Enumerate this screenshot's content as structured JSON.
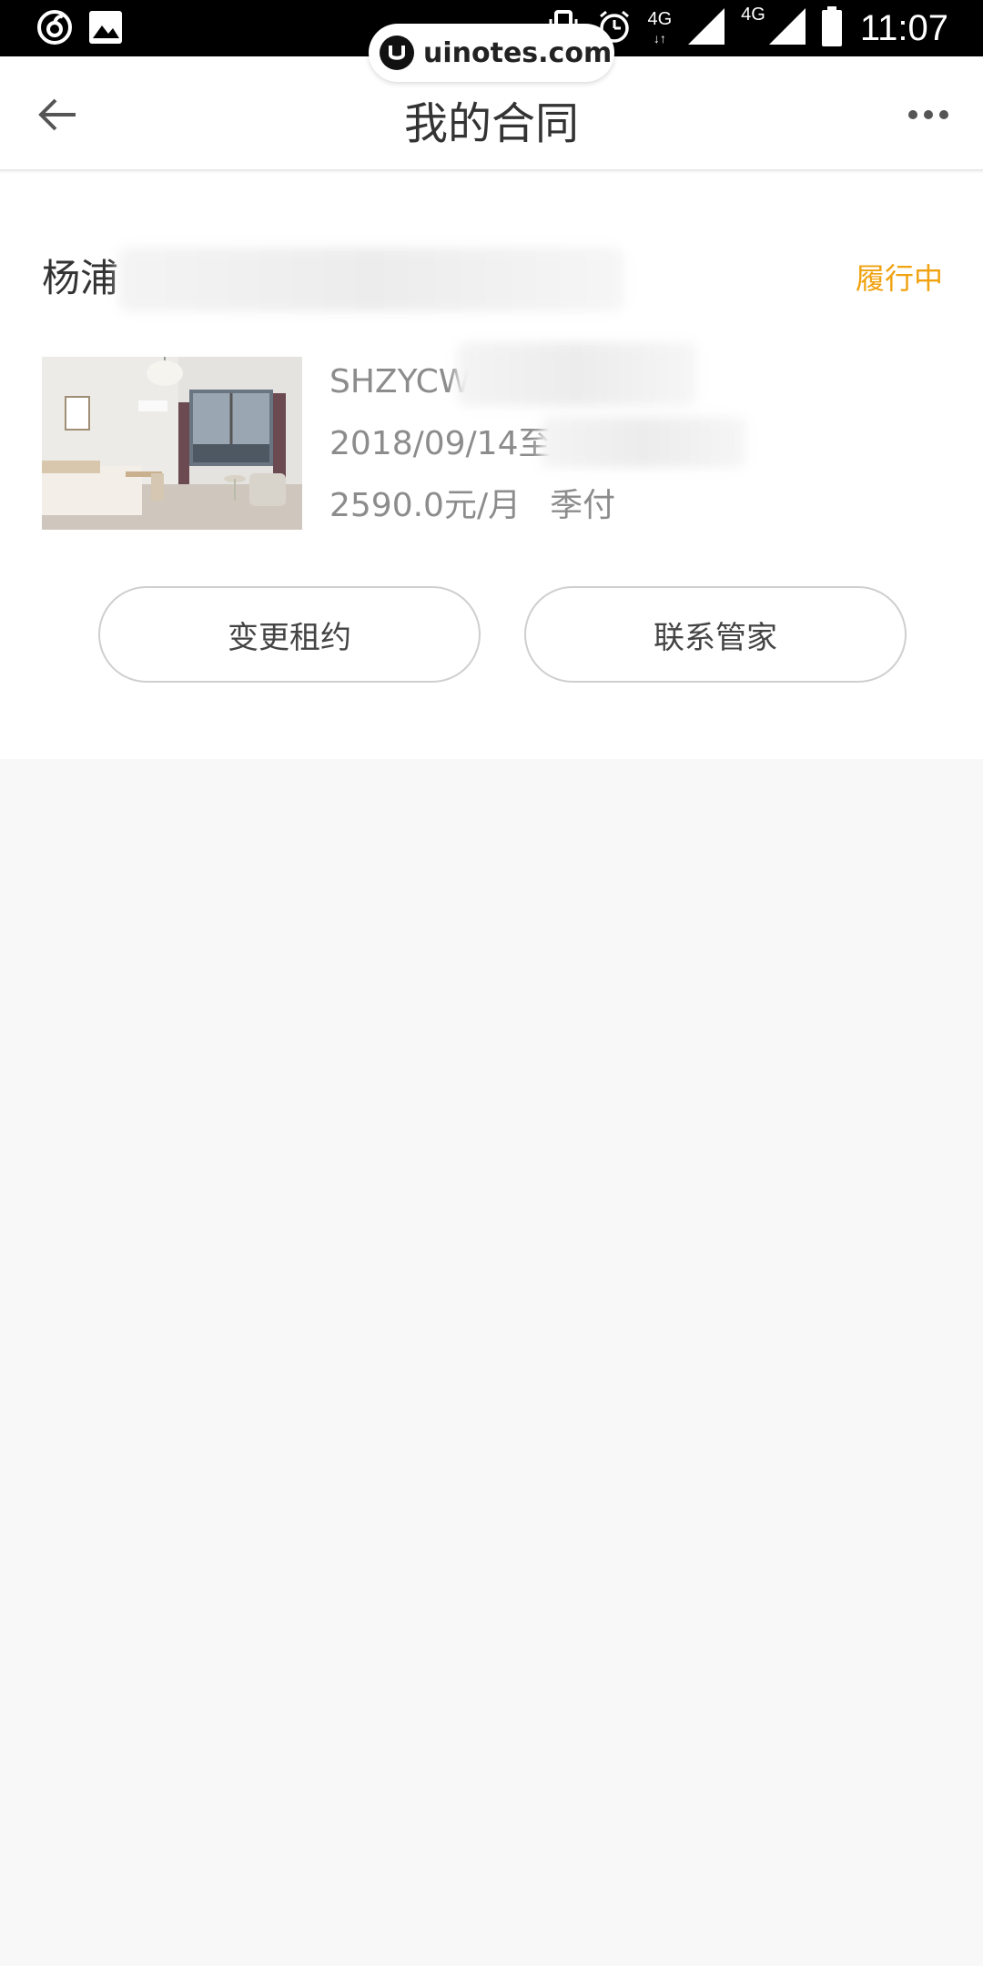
{
  "status_bar": {
    "time": "11:07",
    "network_1": "4G",
    "network_2": "4G",
    "icons": [
      "netease-music-icon",
      "gallery-icon",
      "vibrate-icon",
      "alarm-icon",
      "signal-icon",
      "battery-icon"
    ]
  },
  "watermark": {
    "text": "uinotes.com"
  },
  "header": {
    "title": "我的合同",
    "back_icon": "arrow-left-icon",
    "more_icon": "more-dots-icon"
  },
  "contract": {
    "address_visible": "杨浦",
    "status": "履行中",
    "code_visible": "SHZYCW",
    "date_visible": "2018/09/14至",
    "rent": "2590.0元/月",
    "payment": "季付",
    "status_color": "#f0a20f"
  },
  "actions": {
    "change_lease": "变更租约",
    "contact_manager": "联系管家"
  }
}
